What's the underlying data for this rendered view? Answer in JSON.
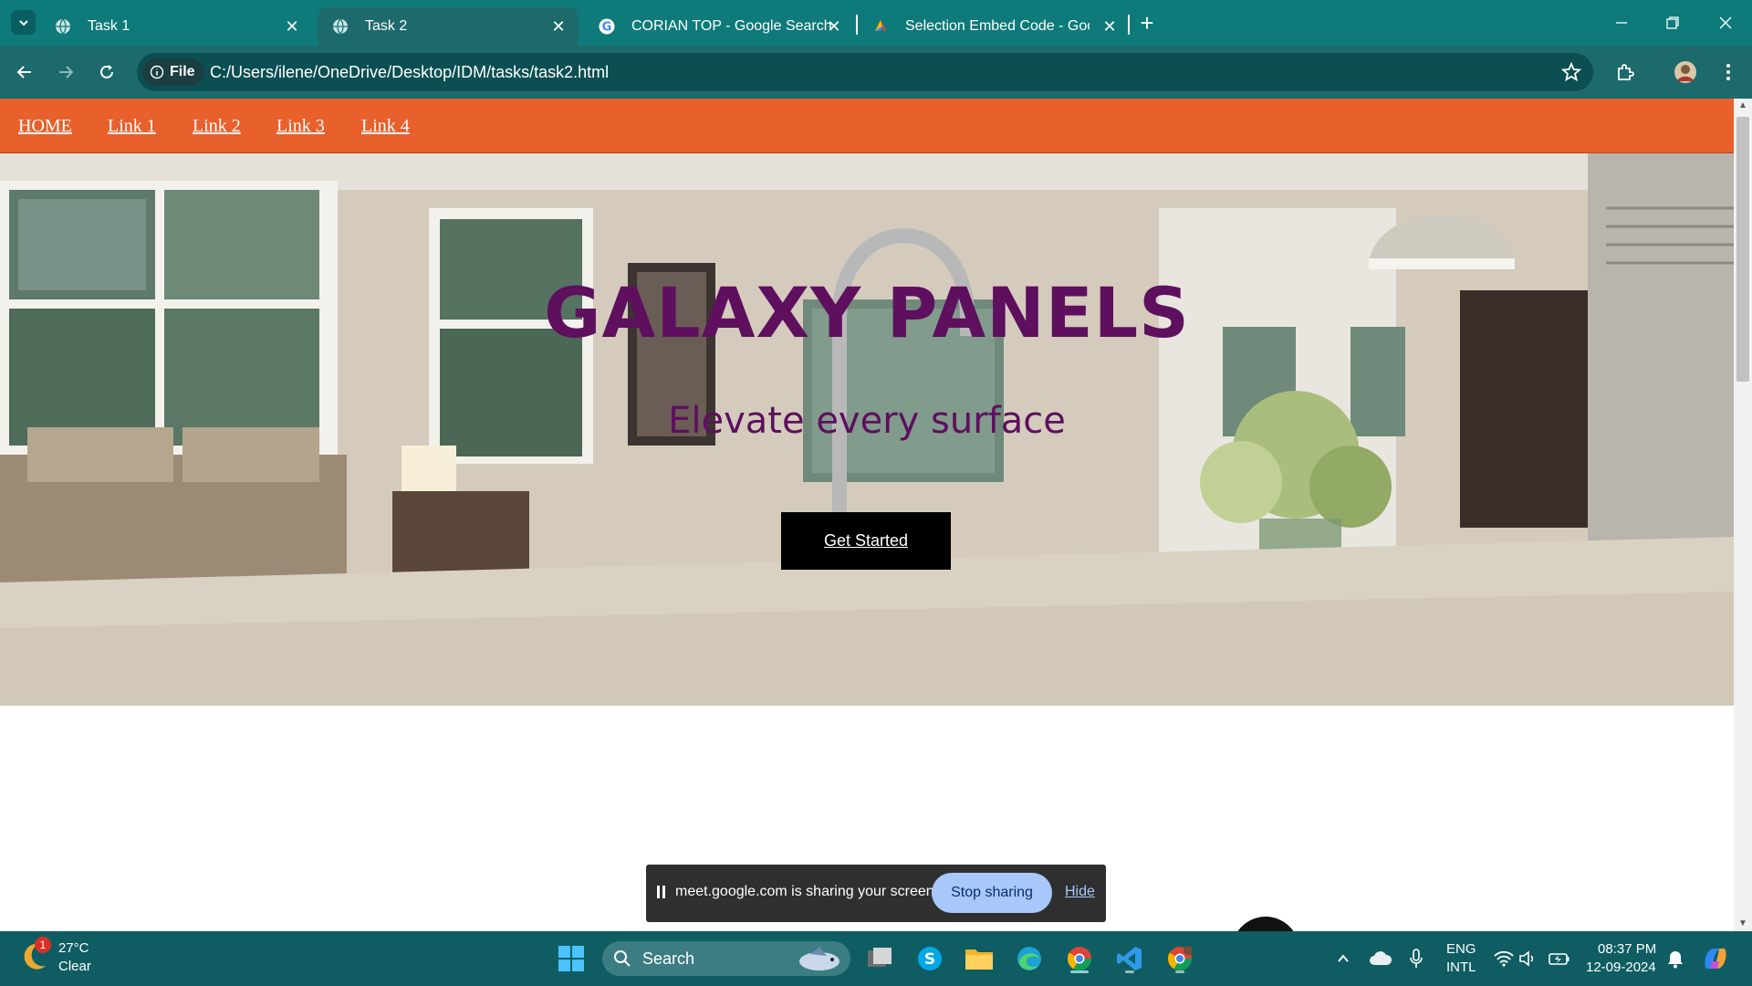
{
  "browser": {
    "tabs": [
      {
        "title": "Task 1",
        "active": false
      },
      {
        "title": "Task 2",
        "active": true
      },
      {
        "title": "CORIAN TOP - Google Search",
        "active": false
      },
      {
        "title": "Selection Embed Code - Googl",
        "active": false
      }
    ],
    "address_chip": "File",
    "url": "C:/Users/ilene/OneDrive/Desktop/IDM/tasks/task2.html"
  },
  "site": {
    "nav": [
      "HOME",
      "Link 1",
      "Link 2",
      "Link 3",
      "Link 4"
    ],
    "hero_title": "GALAXY PANELS",
    "hero_subtitle": "Elevate every surface",
    "cta_label": "Get Started"
  },
  "share_banner": {
    "message": "meet.google.com is sharing your screen.",
    "stop_label": "Stop sharing",
    "hide_label": "Hide"
  },
  "taskbar": {
    "weather_badge": "1",
    "temperature": "27°C",
    "condition": "Clear",
    "search_label": "Search",
    "language_top": "ENG",
    "language_bottom": "INTL",
    "time": "08:37 PM",
    "date": "12-09-2024"
  },
  "colors": {
    "tab_strip": "#0e7a7a",
    "site_nav": "#e8602c",
    "hero_text": "#5e0f5e"
  }
}
